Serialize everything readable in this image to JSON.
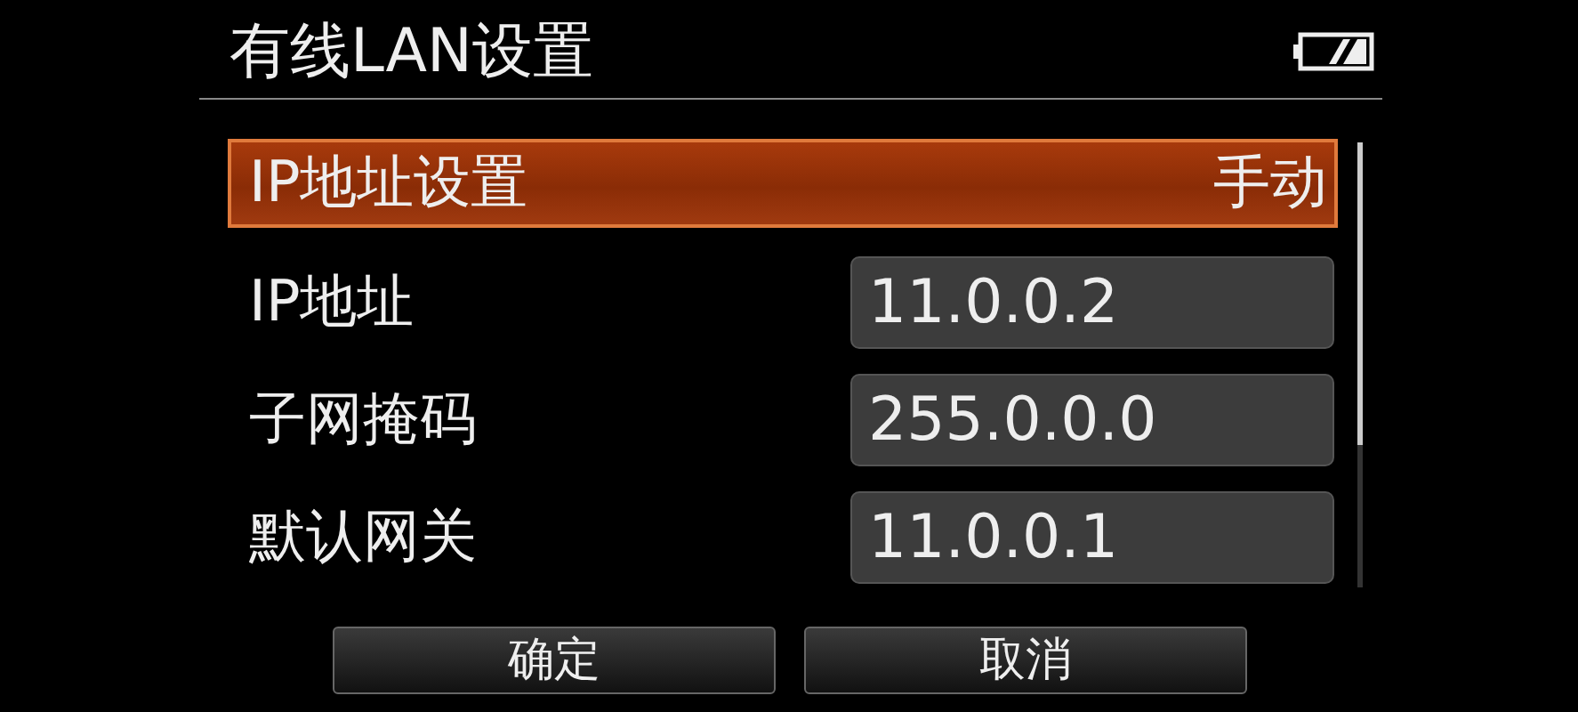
{
  "title": "有线LAN设置",
  "items": [
    {
      "kind": "option",
      "label": "IP地址设置",
      "value": "手动",
      "selected": true
    },
    {
      "kind": "field",
      "label": "IP地址",
      "value": "11.0.0.2",
      "selected": false
    },
    {
      "kind": "field",
      "label": "子网掩码",
      "value": "255.0.0.0",
      "selected": false
    },
    {
      "kind": "field",
      "label": "默认网关",
      "value": "11.0.0.1",
      "selected": false
    }
  ],
  "buttons": [
    "确定",
    "取消"
  ]
}
